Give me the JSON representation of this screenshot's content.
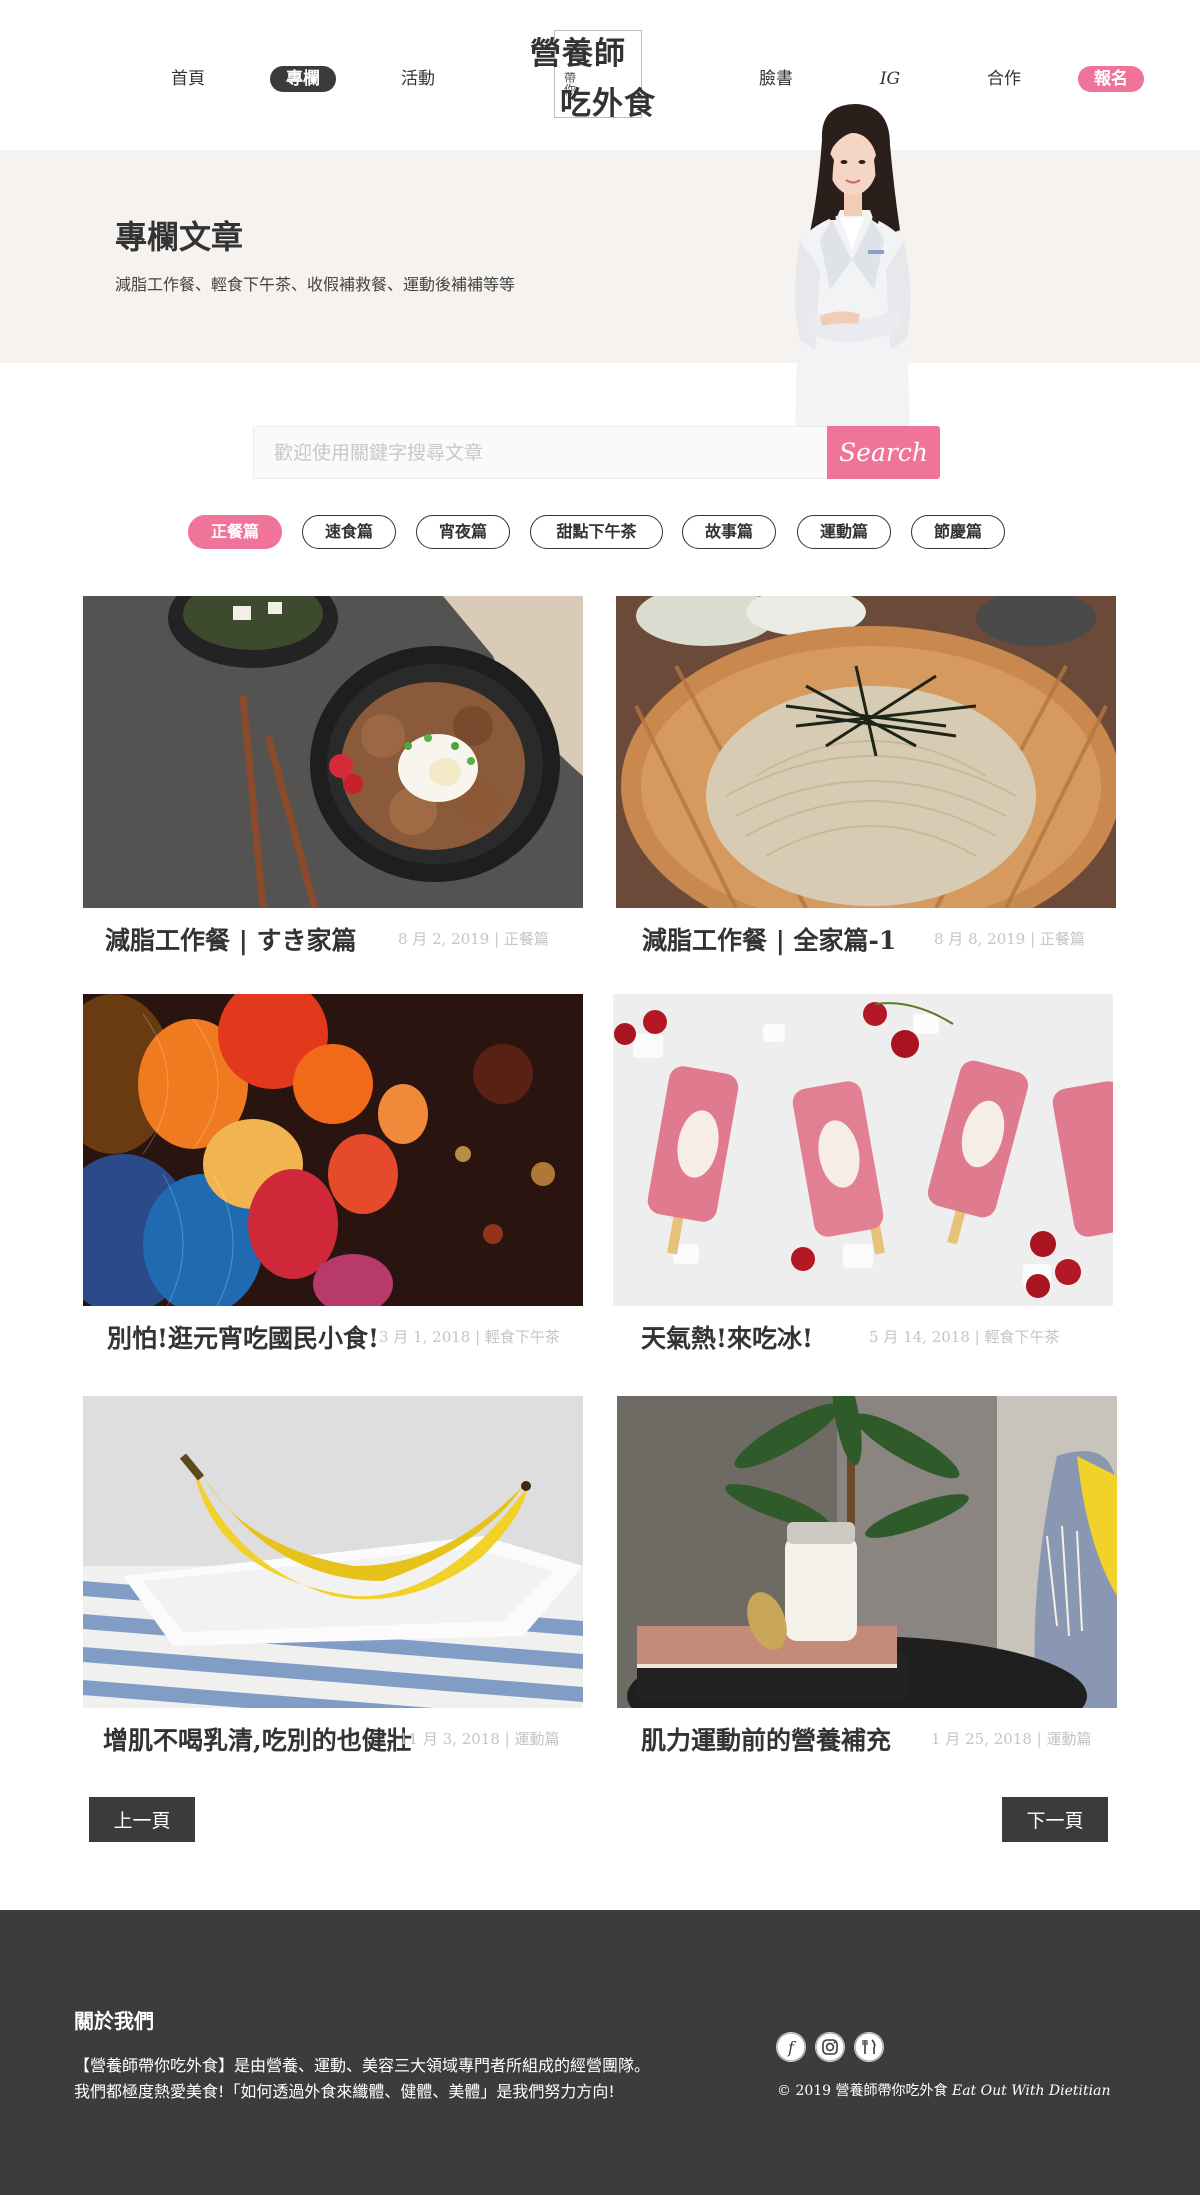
{
  "header": {
    "nav_left": [
      {
        "label": "首頁"
      },
      {
        "label": "專欄"
      },
      {
        "label": "活動"
      }
    ],
    "nav_right": [
      {
        "label": "臉書"
      },
      {
        "label": "IG"
      },
      {
        "label": "合作"
      },
      {
        "label": "報名"
      }
    ],
    "active_nav": "專欄",
    "logo": {
      "line1": "營養師",
      "small": "帶你",
      "line2": "吃外食"
    }
  },
  "hero": {
    "title": "專欄文章",
    "subtitle": "減脂工作餐、輕食下午茶、收假補救餐、運動後補補等等"
  },
  "search": {
    "placeholder": "歡迎使用關鍵字搜尋文章",
    "button_label": "Search"
  },
  "categories": [
    {
      "label": "正餐篇",
      "active": true
    },
    {
      "label": "速食篇",
      "active": false
    },
    {
      "label": "宵夜篇",
      "active": false
    },
    {
      "label": "甜點下午茶",
      "active": false
    },
    {
      "label": "故事篇",
      "active": false
    },
    {
      "label": "運動篇",
      "active": false
    },
    {
      "label": "節慶篇",
      "active": false
    }
  ],
  "articles": [
    {
      "title": "減脂工作餐 | すき家篇",
      "meta": "8 月 2, 2019 | 正餐篇",
      "image": "beef-rice-bowl"
    },
    {
      "title": "減脂工作餐 | 全家篇-1",
      "meta": "8 月 8, 2019 | 正餐篇",
      "image": "soba-noodles"
    },
    {
      "title": "別怕!逛元宵吃國民小食!",
      "meta": "3 月 1, 2018 | 輕食下午茶",
      "image": "lanterns"
    },
    {
      "title": "天氣熱!來吃冰!",
      "meta": "5 月 14, 2018 | 輕食下午茶",
      "image": "popsicles"
    },
    {
      "title": "增肌不喝乳清,吃別的也健壯",
      "meta": "11 月 3, 2018 | 運動篇",
      "image": "banana"
    },
    {
      "title": "肌力運動前的營養補充",
      "meta": "1 月 25, 2018 | 運動篇",
      "image": "milk-jar"
    }
  ],
  "pager": {
    "prev": "上一頁",
    "next": "下一頁"
  },
  "footer": {
    "about_title": "關於我們",
    "about_line1": "【營養師帶你吃外食】是由營養、運動、美容三大領域專門者所組成的經營團隊。",
    "about_line2": "我們都極度熱愛美食!「如何透過外食來纖體、健體、美體」是我們努力方向!",
    "social_icons": [
      "facebook-icon",
      "instagram-icon",
      "fork-knife-icon"
    ],
    "copyright_zh": "© 2019 營養師帶你吃外食",
    "copyright_en": "Eat Out With Dietitian"
  },
  "colors": {
    "accent": "#f0739a",
    "dark": "#3b3b3b",
    "hero_bg": "#f5f2ef",
    "footer_bg": "#3c3c3c"
  }
}
